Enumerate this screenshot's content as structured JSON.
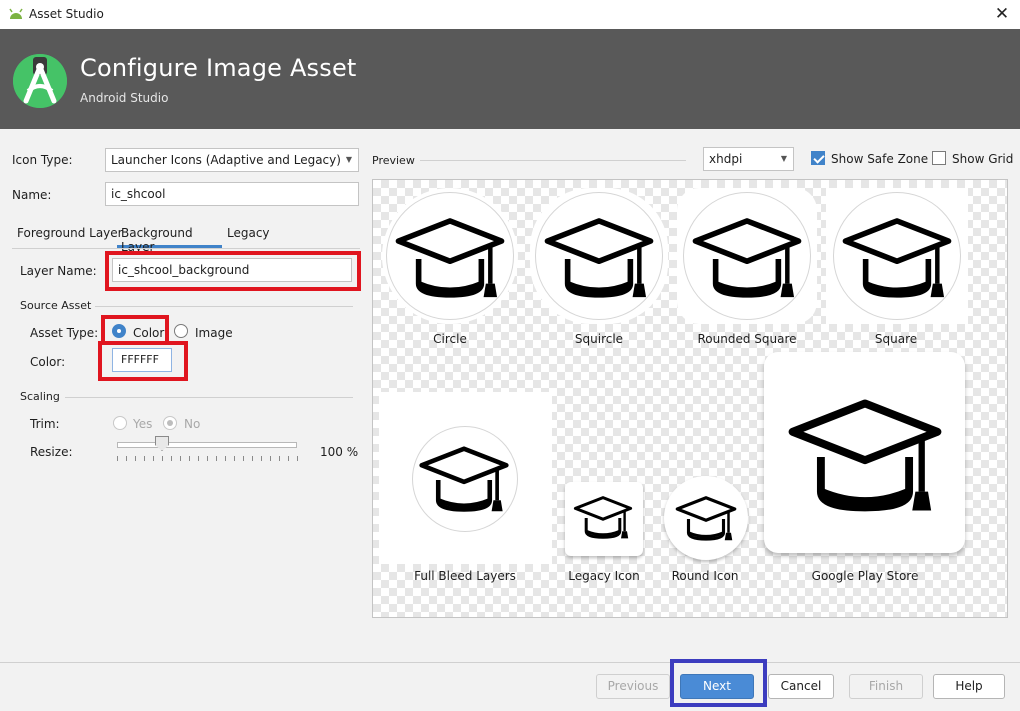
{
  "window": {
    "title": "Asset Studio",
    "close_glyph": "✕"
  },
  "header": {
    "title": "Configure Image Asset",
    "subtitle": "Android Studio"
  },
  "form": {
    "icon_type_label": "Icon Type:",
    "icon_type_value": "Launcher Icons (Adaptive and Legacy)",
    "name_label": "Name:",
    "name_value": "ic_shcool"
  },
  "tabs": [
    "Foreground Layer",
    "Background Layer",
    "Legacy"
  ],
  "layer": {
    "layer_name_label": "Layer Name:",
    "layer_name_value": "ic_shcool_background",
    "source_asset_title": "Source Asset",
    "asset_type_label": "Asset Type:",
    "asset_type_options": [
      "Color",
      "Image"
    ],
    "color_label": "Color:",
    "color_value": "FFFFFF",
    "scaling_title": "Scaling",
    "trim_label": "Trim:",
    "trim_options": [
      "Yes",
      "No"
    ],
    "resize_label": "Resize:",
    "resize_value": "100 %",
    "resize_fraction": 0.25
  },
  "preview": {
    "label": "Preview",
    "density": "xhdpi",
    "show_safe_zone_label": "Show Safe Zone",
    "show_safe_zone_checked": true,
    "show_grid_label": "Show Grid",
    "show_grid_checked": false,
    "icons": [
      "Circle",
      "Squircle",
      "Rounded Square",
      "Square",
      "Full Bleed Layers",
      "Legacy Icon",
      "Round Icon",
      "Google Play Store"
    ]
  },
  "buttons": {
    "previous": "Previous",
    "next": "Next",
    "cancel": "Cancel",
    "finish": "Finish",
    "help": "Help"
  },
  "colors": {
    "highlight_red": "#e0151f",
    "highlight_blue": "#3d3dbf",
    "accent": "#4a8bd6",
    "banner": "#595959"
  },
  "icon_names": [
    "android-studio-icon",
    "graduation-cap-icon",
    "close-icon"
  ]
}
